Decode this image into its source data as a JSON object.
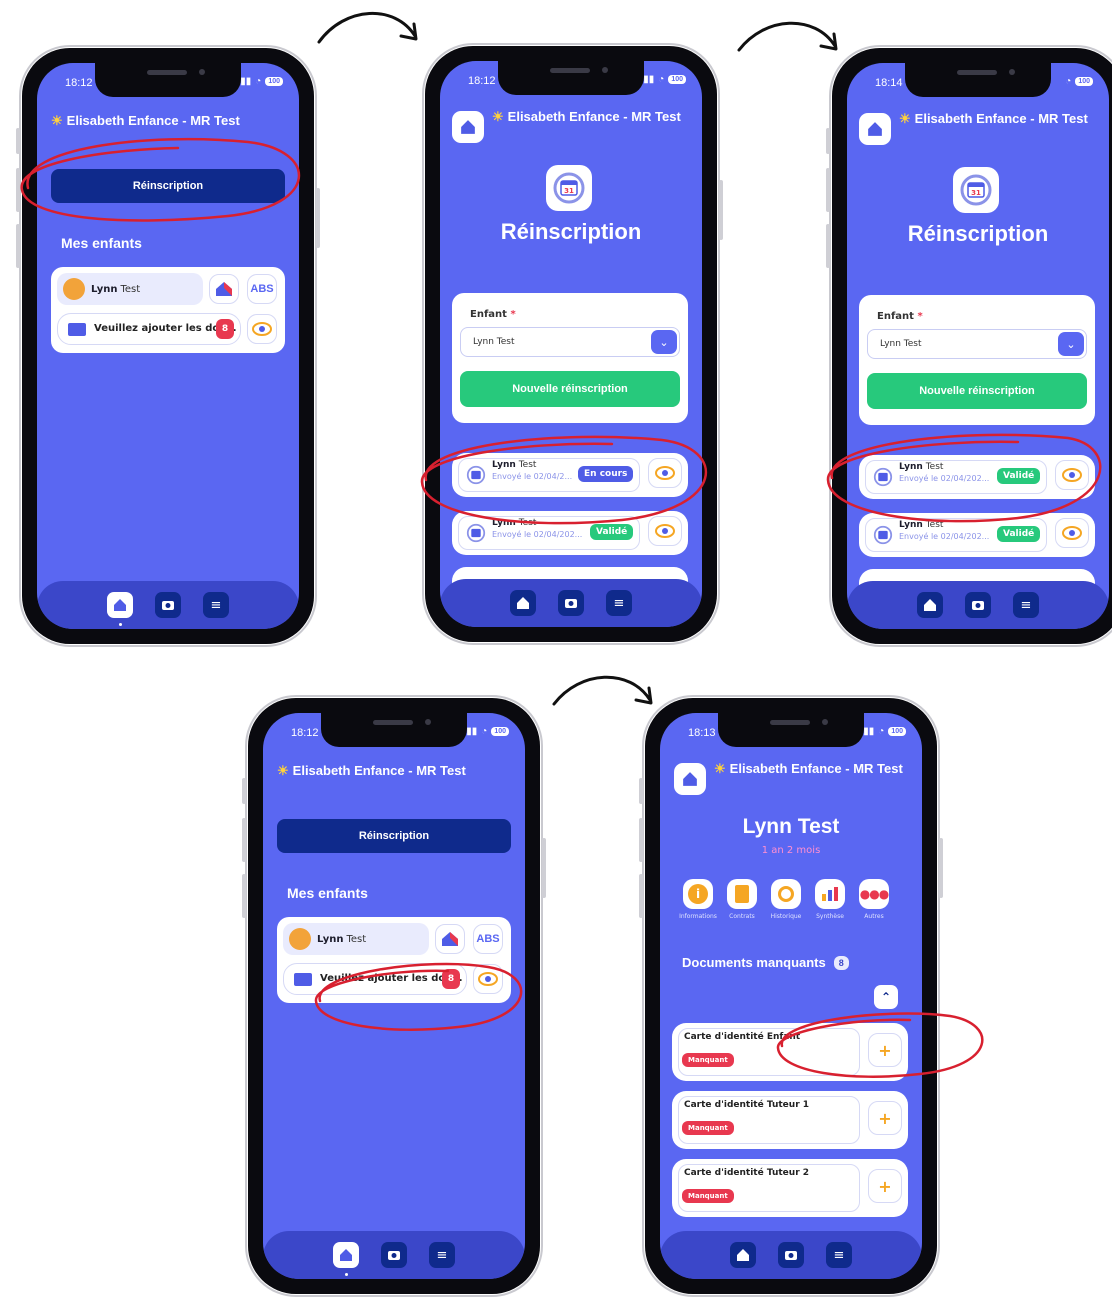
{
  "screen1": {
    "time": "18:12",
    "battery": "100",
    "header": "Elisabeth Enfance - MR Test",
    "reinscription_button": "Réinscription",
    "section_title": "Mes enfants",
    "child_first": "Lynn",
    "child_last": "Test",
    "abs_label": "ABS",
    "doc_text": "Veuillez ajouter les doc...",
    "doc_count": "8"
  },
  "screen2": {
    "time": "18:12",
    "battery": "100",
    "header": "Elisabeth Enfance - MR Test",
    "page_title": "Réinscription",
    "enfant_label": "Enfant",
    "required_mark": "*",
    "select_value": "Lynn Test",
    "new_button": "Nouvelle réinscription",
    "rows": [
      {
        "first": "Lynn",
        "last": "Test",
        "date": "Envoyé le 02/04/2...",
        "status": "En cours"
      },
      {
        "first": "Lynn",
        "last": "Test",
        "date": "Envoyé le 02/04/202...",
        "status": "Validé"
      }
    ]
  },
  "screen3": {
    "time": "18:14",
    "battery": "100",
    "header": "Elisabeth Enfance - MR Test",
    "page_title": "Réinscription",
    "enfant_label": "Enfant",
    "required_mark": "*",
    "select_value": "Lynn Test",
    "new_button": "Nouvelle réinscription",
    "rows": [
      {
        "first": "Lynn",
        "last": "Test",
        "date": "Envoyé le 02/04/202...",
        "status": "Validé"
      },
      {
        "first": "Lynn",
        "last": "Test",
        "date": "Envoyé le 02/04/202...",
        "status": "Validé"
      }
    ]
  },
  "screen4": {
    "time": "18:12",
    "battery": "100",
    "header": "Elisabeth Enfance - MR Test",
    "reinscription_button": "Réinscription",
    "section_title": "Mes enfants",
    "child_first": "Lynn",
    "child_last": "Test",
    "abs_label": "ABS",
    "doc_text": "Veuillez ajouter les doc...",
    "doc_count": "8"
  },
  "screen5": {
    "time": "18:13",
    "battery": "100",
    "header": "Elisabeth Enfance - MR Test",
    "child_name": "Lynn Test",
    "age": "1 an 2 mois",
    "menu": [
      "Informations",
      "Contrats",
      "Historique",
      "Synthèse",
      "Autres"
    ],
    "docs_title": "Documents manquants",
    "docs_count": "8",
    "missing_label": "Manquant",
    "documents": [
      "Carte d'identité Enfant",
      "Carte d'identité Tuteur 1",
      "Carte d'identité Tuteur 2"
    ]
  },
  "colors": {
    "screen_bg": "#5a67f2",
    "dark_button": "#0f2a8c",
    "success": "#27c97c",
    "danger": "#e8384f",
    "annotation": "#d8202f"
  }
}
